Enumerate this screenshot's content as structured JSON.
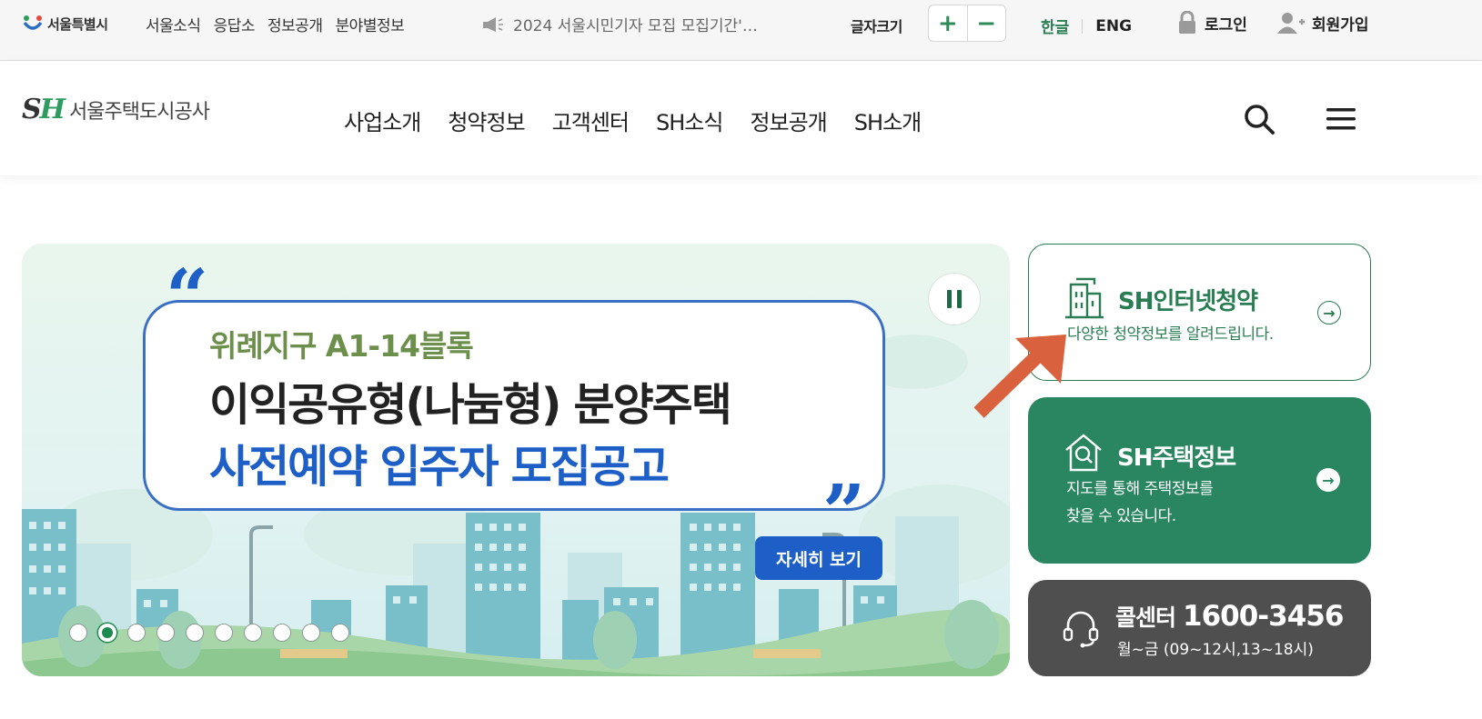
{
  "utility_bar": {
    "seoul_logo": "서울특별시",
    "links": [
      "서울소식",
      "응답소",
      "정보공개",
      "분야별정보"
    ],
    "ticker": "2024 서울시민기자 모집 모집기간'…",
    "font_size_label": "글자크기",
    "font_increase": "+",
    "font_decrease": "−",
    "lang_ko": "한글",
    "lang_en": "ENG",
    "login": "로그인",
    "signup": "회원가입"
  },
  "header": {
    "logo_mark": "SH",
    "logo_name": "서울주택도시공사",
    "nav": [
      "사업소개",
      "청약정보",
      "고객센터",
      "SH소식",
      "정보공개",
      "SH소개"
    ]
  },
  "hero": {
    "subtitle": "위례지구 A1-14블록",
    "line1": "이익공유형(나눔형) 분양주택",
    "line2": "사전예약 입주자 모집공고",
    "detail_button": "자세히 보기",
    "slides_total": 10,
    "active_slide": 2
  },
  "cards": {
    "apply": {
      "title": "SH인터넷청약",
      "desc": "다양한 청약정보를 알려드립니다."
    },
    "housing": {
      "title": "SH주택정보",
      "desc_line1": "지도를 통해 주택정보를",
      "desc_line2": "찾을 수 있습니다."
    },
    "call": {
      "label": "콜센터",
      "number": "1600-3456",
      "hours": "월~금 (09~12시,13~18시)"
    }
  },
  "colors": {
    "brand_green": "#2a7d53",
    "card_green": "#2a8660",
    "hero_blue": "#1d5fc6",
    "call_gray": "#4f4f4f",
    "arrow_orange": "#d9613e"
  }
}
